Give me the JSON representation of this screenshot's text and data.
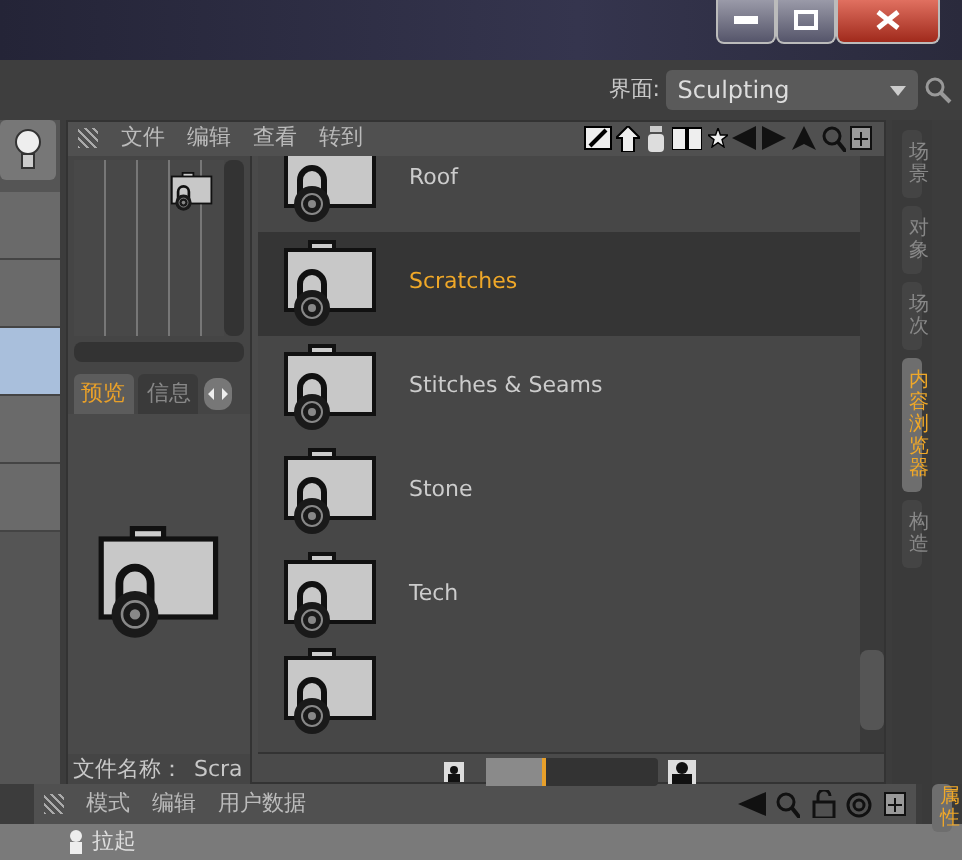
{
  "interface_picker": {
    "label": "界面:",
    "value": "Sculpting"
  },
  "content_library": {
    "menus": [
      "文件",
      "编辑",
      "查看",
      "转到"
    ],
    "preview_tabs": [
      {
        "label": "预览",
        "selected": true
      },
      {
        "label": "信息",
        "selected": false
      }
    ],
    "file_name": {
      "label": "文件名称：",
      "value": "Scra"
    },
    "items": [
      {
        "label": "Roof",
        "selected": false
      },
      {
        "label": "Scratches",
        "selected": true
      },
      {
        "label": "Stitches & Seams",
        "selected": false
      },
      {
        "label": "Stone",
        "selected": false
      },
      {
        "label": "Tech",
        "selected": false
      }
    ],
    "thumbnail_size": {
      "level": 0.35
    }
  },
  "side_tabs": [
    {
      "label": "场景",
      "selected": false
    },
    {
      "label": "对象",
      "selected": false
    },
    {
      "label": "场次",
      "selected": false
    },
    {
      "label": "内容浏览器",
      "selected": true
    },
    {
      "label": "构造",
      "selected": false
    }
  ],
  "bottom_panel": {
    "menus": [
      "模式",
      "编辑",
      "用户数据"
    ],
    "side_tabs": [
      {
        "label": "属性",
        "selected": true
      }
    ]
  },
  "bottom_row": {
    "label": "拉起"
  }
}
